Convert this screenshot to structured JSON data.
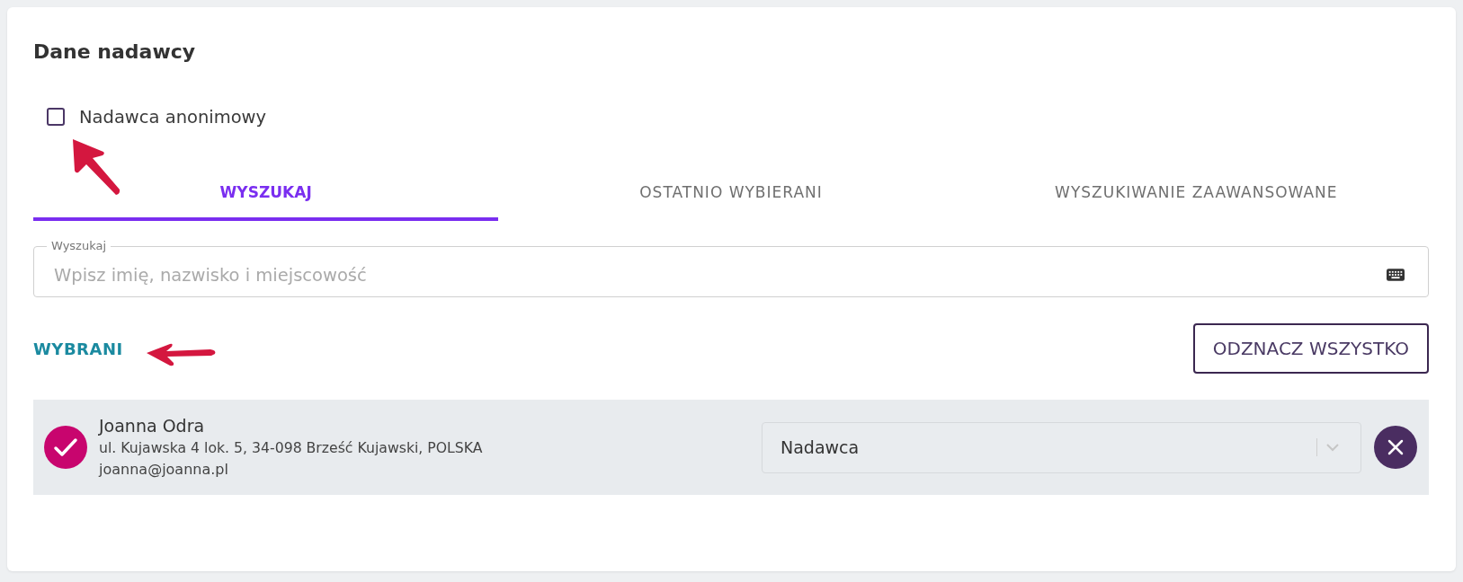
{
  "section": {
    "title": "Dane nadawcy"
  },
  "anonymous": {
    "label": "Nadawca anonimowy",
    "checked": false
  },
  "tabs": [
    {
      "label": "WYSZUKAJ",
      "selected": true
    },
    {
      "label": "OSTATNIO WYBIERANI",
      "selected": false
    },
    {
      "label": "WYSZUKIWANIE ZAAWANSOWANE",
      "selected": false
    }
  ],
  "search": {
    "label": "Wyszukaj",
    "placeholder": "Wpisz imię, nazwisko i miejscowość"
  },
  "selected_section": {
    "heading": "WYBRANI",
    "clear_button": "ODZNACZ WSZYSTKO"
  },
  "selected_people": [
    {
      "name": "Joanna Odra",
      "address": "ul. Kujawska 4 lok. 5, 34-098 Brześć Kujawski, POLSKA",
      "email": "joanna@joanna.pl",
      "checked": true,
      "role": "Nadawca"
    }
  ]
}
